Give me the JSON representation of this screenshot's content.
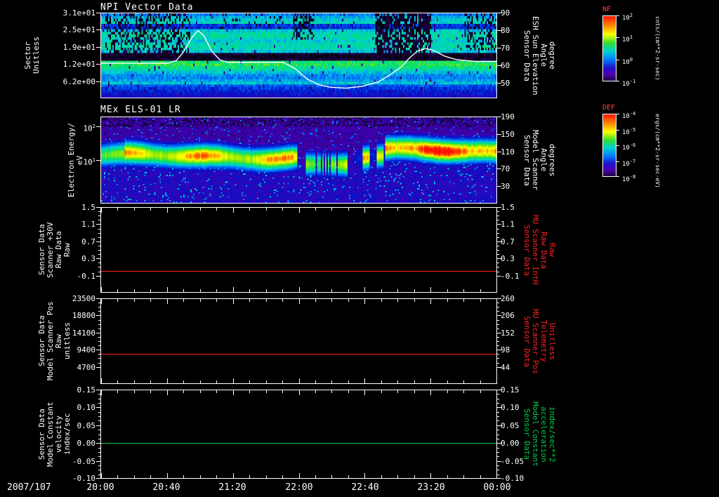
{
  "colors": {
    "background": "#000000",
    "foreground": "#ffffff",
    "red_series": "#ff2020",
    "green_series": "#00cc44",
    "colorbar_title": "#ff4040"
  },
  "xaxis": {
    "date_label": "2007/107",
    "ticks": [
      {
        "frac": 0.0,
        "label": "20:00"
      },
      {
        "frac": 0.1667,
        "label": "20:40"
      },
      {
        "frac": 0.3333,
        "label": "21:20"
      },
      {
        "frac": 0.5,
        "label": "22:00"
      },
      {
        "frac": 0.6667,
        "label": "22:40"
      },
      {
        "frac": 0.8333,
        "label": "23:20"
      },
      {
        "frac": 1.0,
        "label": "00:00"
      }
    ]
  },
  "chart_data": [
    {
      "type": "spectrogram",
      "title": "NPI Vector Data",
      "left_title": "Sector\nUnitless",
      "left_range": [
        0,
        31
      ],
      "left_ticks": [
        {
          "label": "3.1e+01",
          "value": 31
        },
        {
          "label": "2.5e+01",
          "value": 24.8
        },
        {
          "label": "1.9e+01",
          "value": 18.6
        },
        {
          "label": "1.2e+01",
          "value": 12.4
        },
        {
          "label": "6.2e+00",
          "value": 6.2
        }
      ],
      "right_title": "Sensor Data\nESH Sun Elevation\nAngle\ndegree",
      "right_range": [
        41,
        90
      ],
      "right_ticks": [
        {
          "label": "90",
          "value": 90
        },
        {
          "label": "80",
          "value": 80
        },
        {
          "label": "70",
          "value": 70
        },
        {
          "label": "60",
          "value": 60
        },
        {
          "label": "50",
          "value": 50
        }
      ],
      "overlay_line": {
        "name": "ESH Sun Elevation Angle (degree)",
        "color": "#ffffff",
        "axis": "right",
        "points": [
          [
            0,
            61
          ],
          [
            0.1,
            61
          ],
          [
            0.17,
            61
          ],
          [
            0.19,
            62.5
          ],
          [
            0.21,
            68
          ],
          [
            0.23,
            76
          ],
          [
            0.245,
            80
          ],
          [
            0.26,
            77
          ],
          [
            0.28,
            68
          ],
          [
            0.3,
            63
          ],
          [
            0.32,
            61.5
          ],
          [
            0.4,
            61.5
          ],
          [
            0.46,
            61.5
          ],
          [
            0.49,
            58
          ],
          [
            0.52,
            52
          ],
          [
            0.55,
            48.5
          ],
          [
            0.58,
            47
          ],
          [
            0.62,
            46.5
          ],
          [
            0.66,
            47.5
          ],
          [
            0.7,
            50
          ],
          [
            0.73,
            54
          ],
          [
            0.76,
            59
          ],
          [
            0.78,
            64
          ],
          [
            0.8,
            68
          ],
          [
            0.82,
            69.5
          ],
          [
            0.84,
            68.5
          ],
          [
            0.87,
            65
          ],
          [
            0.9,
            63
          ],
          [
            0.95,
            62
          ],
          [
            1,
            62
          ]
        ]
      },
      "spectro": {
        "kind": "npi",
        "rows": 32,
        "cols": 284,
        "seed": 7,
        "row_values": [
          0.5,
          0.56,
          0.6,
          0.62,
          0.4,
          0.38,
          0.58,
          0.63,
          0.65,
          0.62,
          0.6,
          0.63,
          0.64,
          0.62,
          0.58,
          0.06,
          0.05,
          0.07,
          0.7,
          0.72,
          0.68,
          0.63,
          0.58,
          0.52,
          0.5,
          0.54,
          0.58,
          0.44,
          0.4,
          0.36,
          0.34,
          0.3
        ],
        "speckle_regions": [
          {
            "t0": 0.01,
            "t1": 0.225,
            "r0": 0,
            "r1": 14,
            "density": 0.4
          },
          {
            "t0": 0.3,
            "t1": 0.46,
            "r0": 0,
            "r1": 5,
            "density": 0.1
          },
          {
            "t0": 0.485,
            "t1": 0.54,
            "r0": 0,
            "r1": 9,
            "density": 0.45
          },
          {
            "t0": 0.695,
            "t1": 0.835,
            "r0": 0,
            "r1": 17,
            "density": 0.7
          },
          {
            "t0": 0.92,
            "t1": 1.0,
            "r0": 0,
            "r1": 13,
            "density": 0.35
          }
        ]
      }
    },
    {
      "type": "spectrogram",
      "title": "MEx ELS-01 LR",
      "left_title": "Electron Energy/\neV",
      "left_scale": "log",
      "left_range": [
        0.5,
        200
      ],
      "left_ticks": [
        {
          "label": "10",
          "sup": "2",
          "value": 100
        },
        {
          "label": "10",
          "sup": "1",
          "value": 10
        }
      ],
      "right_title": "Sensor Data\nModel Scanner\nAngle\ndegrees",
      "right_range": [
        -10,
        190
      ],
      "right_ticks": [
        {
          "label": "190",
          "value": 190
        },
        {
          "label": "150",
          "value": 150
        },
        {
          "label": "110",
          "value": 110
        },
        {
          "label": "70",
          "value": 70
        },
        {
          "label": "30",
          "value": 30
        }
      ],
      "spectro": {
        "kind": "els",
        "rows": 64,
        "cols": 284,
        "seed": 11,
        "log_top": 2.301,
        "log_span": 2.602,
        "sigma": 0.3,
        "dark_bands": [
          [
            0.498,
            0.516
          ],
          [
            0.622,
            0.646
          ]
        ],
        "segments": [
          {
            "t1": 0.06,
            "center": 1.08,
            "inten": 0.74
          },
          {
            "t1": 0.505,
            "center": 1.12,
            "inten": 0.88
          },
          {
            "t1": 0.635,
            "center": 0.87,
            "inten": 0.82,
            "gaps": 0.22
          },
          {
            "t1": 0.72,
            "center": 1.05,
            "inten": 0.85,
            "stripes": true
          },
          {
            "t1": 1.01,
            "center": 1.27,
            "inten": 0.97
          }
        ]
      }
    },
    {
      "type": "line",
      "left_title": "Sensor Data\nScanner +30V\nRaw Data\nRaw",
      "left_range": [
        -0.5,
        1.5
      ],
      "left_ticks": [
        {
          "label": "1.5",
          "value": 1.5
        },
        {
          "label": "1.1",
          "value": 1.1
        },
        {
          "label": "0.7",
          "value": 0.7
        },
        {
          "label": "0.3",
          "value": 0.3
        },
        {
          "label": "-0.1",
          "value": -0.1
        }
      ],
      "right_title": "Sensor Data\nMU Scanner IntH\nRaw Data\nRaw",
      "right_color": "#ff2020",
      "right_range": [
        -0.5,
        1.5
      ],
      "right_ticks": [
        {
          "label": "1.5",
          "value": 1.5
        },
        {
          "label": "1.1",
          "value": 1.1
        },
        {
          "label": "0.7",
          "value": 0.7
        },
        {
          "label": "0.3",
          "value": 0.3
        },
        {
          "label": "-0.1",
          "value": -0.1
        }
      ],
      "series": [
        {
          "name": "Scanner +30V Raw Data",
          "color": "#ff2020",
          "axis": "left",
          "value": 0.0
        }
      ]
    },
    {
      "type": "line",
      "left_title": "Sensor Data\nModel Scanner Pos\nRaw\nunitless",
      "left_range": [
        0,
        23500
      ],
      "left_ticks": [
        {
          "label": "23500",
          "value": 23500
        },
        {
          "label": "18800",
          "value": 18800
        },
        {
          "label": "14100",
          "value": 14100
        },
        {
          "label": "9400",
          "value": 9400
        },
        {
          "label": "4700",
          "value": 4700
        }
      ],
      "right_title": "Sensor Data\nMU Scanner Pos\nTelemetry\nUnitless",
      "right_color": "#ff2020",
      "right_range": [
        -10,
        260
      ],
      "right_ticks": [
        {
          "label": "260",
          "value": 260
        },
        {
          "label": "206",
          "value": 206
        },
        {
          "label": "152",
          "value": 152
        },
        {
          "label": "98",
          "value": 98
        },
        {
          "label": "44",
          "value": 44
        }
      ],
      "series": [
        {
          "name": "Model Scanner Pos Raw",
          "color": "#ff2020",
          "axis": "left",
          "value": 8200
        }
      ]
    },
    {
      "type": "line",
      "left_title": "Sensor Data\nModel Constant\nvelocity\nindex/sec",
      "left_range": [
        -0.1,
        0.15
      ],
      "left_ticks": [
        {
          "label": "0.15",
          "value": 0.15
        },
        {
          "label": "0.10",
          "value": 0.1
        },
        {
          "label": "0.05",
          "value": 0.05
        },
        {
          "label": "0.00",
          "value": 0.0
        },
        {
          "label": "-0.05",
          "value": -0.05
        },
        {
          "label": "-0.10",
          "value": -0.1
        }
      ],
      "right_title": "Sensor Data\nModel Constant\nacceleration\nindex/sec**2",
      "right_color": "#00cc44",
      "right_range": [
        -0.1,
        0.15
      ],
      "right_ticks": [
        {
          "label": "0.15",
          "value": 0.15
        },
        {
          "label": "0.10",
          "value": 0.1
        },
        {
          "label": "0.05",
          "value": 0.05
        },
        {
          "label": "0.00",
          "value": 0.0
        },
        {
          "label": "-0.05",
          "value": -0.05
        },
        {
          "label": "-0.10",
          "value": -0.1
        }
      ],
      "series": [
        {
          "name": "Model Constant velocity",
          "color": "#00cc44",
          "axis": "left",
          "value": 0.0
        }
      ]
    }
  ],
  "colorbars": [
    {
      "title": "NF",
      "unit": "cnts/(cm**2-sr-sec)",
      "ticks": [
        {
          "frac": 0,
          "label": "10",
          "sup": "2"
        },
        {
          "frac": 0.333,
          "label": "10",
          "sup": "1"
        },
        {
          "frac": 0.667,
          "label": "10",
          "sup": "0"
        },
        {
          "frac": 1,
          "label": "10",
          "sup": "-1"
        }
      ]
    },
    {
      "title": "DEF",
      "unit": "ergs/(cm**2-sr-sec-eV)",
      "ticks": [
        {
          "frac": 0,
          "label": "10",
          "sup": "-4"
        },
        {
          "frac": 0.25,
          "label": "10",
          "sup": "-5"
        },
        {
          "frac": 0.5,
          "label": "10",
          "sup": "-6"
        },
        {
          "frac": 0.75,
          "label": "10",
          "sup": "-7"
        },
        {
          "frac": 1,
          "label": "10",
          "sup": "-8"
        }
      ]
    }
  ]
}
